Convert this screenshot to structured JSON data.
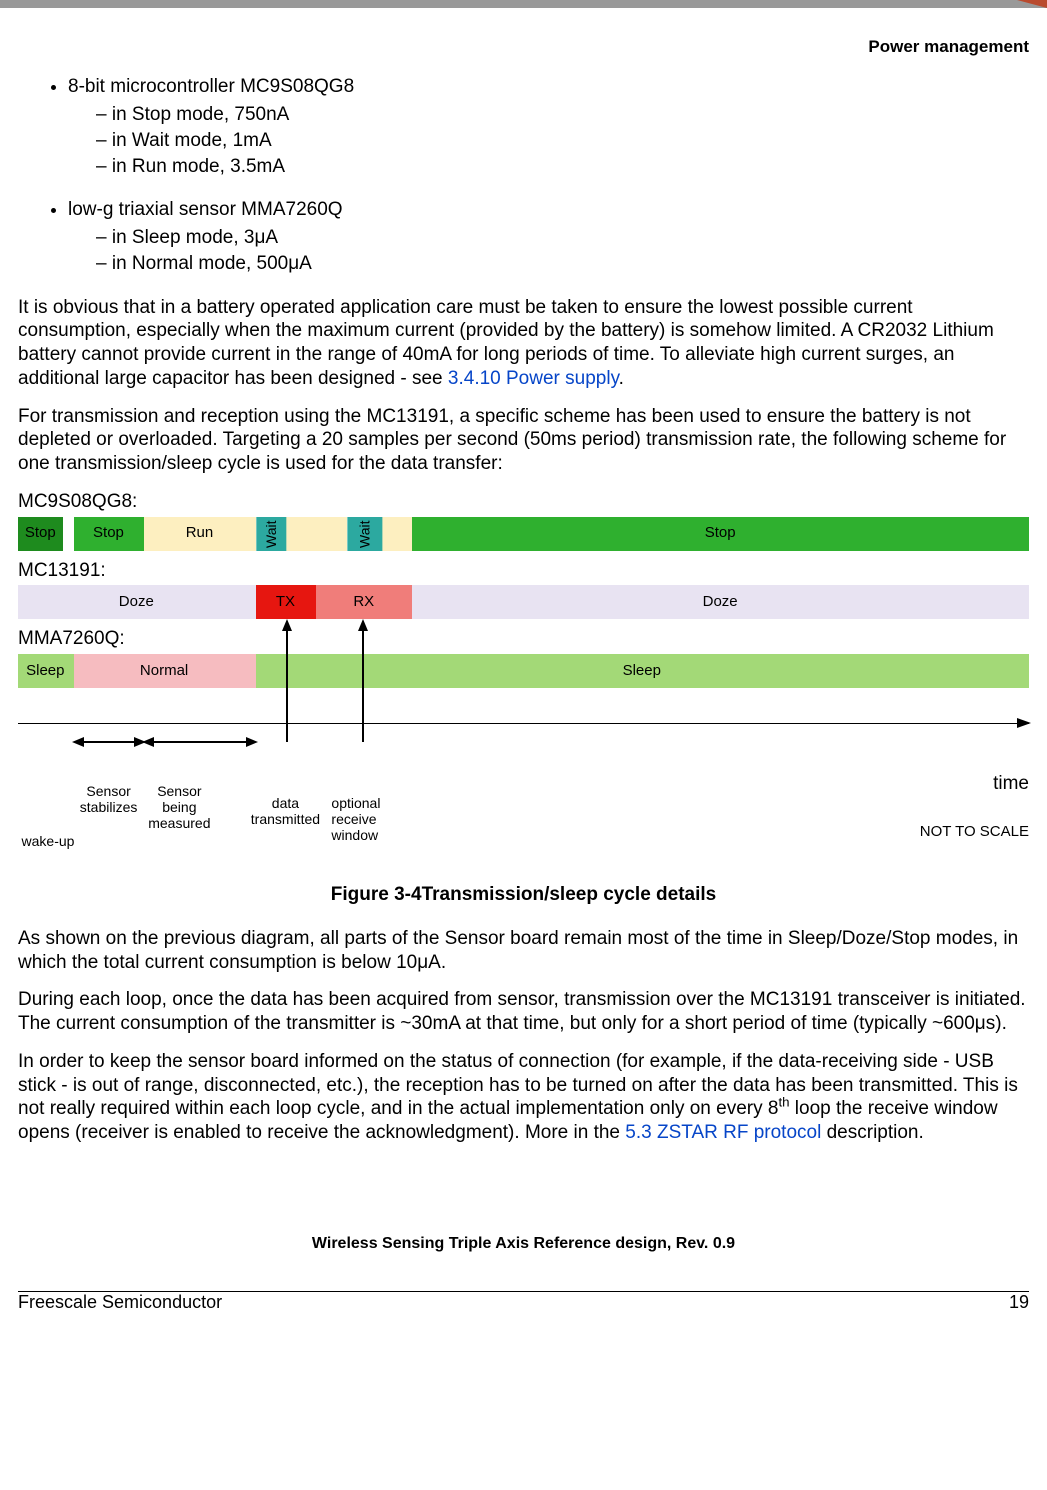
{
  "header": {
    "section": "Power management"
  },
  "bullets": {
    "mcu": {
      "title": "8-bit microcontroller MC9S08QG8",
      "items": [
        "in Stop mode, 750nA",
        "in Wait mode, 1mA",
        "in Run mode, 3.5mA"
      ]
    },
    "sensor": {
      "title": "low-g triaxial sensor MMA7260Q",
      "items": [
        "in Sleep mode, 3μA",
        "in Normal mode, 500μA"
      ]
    }
  },
  "para1_a": "It is obvious that in a battery operated application care must be taken to ensure the lowest possible current consumption, especially when the maximum current (provided by the battery) is somehow limited. A CR2032 Lithium battery cannot provide current in the range of 40mA for long periods of time. To alleviate high current surges, an additional large capacitor has been designed - see ",
  "para1_link": "3.4.10 Power supply",
  "para1_b": ".",
  "para2": "For transmission and reception using the MC13191, a specific scheme has been used to ensure the battery is not depleted or overloaded. Targeting a 20 samples per second (50ms period) transmission rate, the following scheme for one transmission/sleep cycle is used for the data transfer:",
  "diagram": {
    "rows": {
      "mcu": {
        "label": "MC9S08QG8:",
        "segs": [
          "Stop",
          "Stop",
          "Run",
          "Wait",
          "Wait",
          "Stop"
        ]
      },
      "rf": {
        "label": "MC13191:",
        "segs": [
          "Doze",
          "TX",
          "RX",
          "Doze"
        ]
      },
      "sens": {
        "label": "MMA7260Q:",
        "segs": [
          "Sleep",
          "Normal",
          "Sleep"
        ]
      }
    },
    "callouts": {
      "wakeup": "wake-up",
      "stabilizes": "Sensor\nstabilizes",
      "measured": "Sensor\nbeing\nmeasured",
      "tx": "data\ntransmitted",
      "rx": "optional\nreceive\nwindow",
      "time": "time",
      "scale": "NOT TO SCALE"
    },
    "caption_a": "Figure 3-4",
    "caption_b": "Transmission/sleep cycle details"
  },
  "para3": "As shown on the previous diagram, all parts of the Sensor board remain most of the time in Sleep/Doze/Stop modes, in which the total current consumption is below 10μA.",
  "para4": "During each loop, once the data has been acquired from sensor, transmission over the MC13191 transceiver is initiated. The current consumption of the transmitter is ~30mA at that time, but only for a short period of time (typically ~600μs).",
  "para5_a": "In order to keep the sensor board informed on the status of connection (for example, if the data-receiving side - USB stick - is out of range, disconnected, etc.), the reception has to be turned on after the data has been transmitted. This is not really required within each loop cycle, and in the actual implementation only on every 8",
  "para5_sup": "th",
  "para5_b": " loop the receive window opens (receiver is enabled to receive the acknowledgment). More in the ",
  "para5_link": "5.3 ZSTAR RF protocol",
  "para5_c": " description.",
  "footer": {
    "title": "Wireless Sensing Triple Axis Reference design, Rev. 0.9",
    "left": "Freescale Semiconductor",
    "right": "19"
  }
}
